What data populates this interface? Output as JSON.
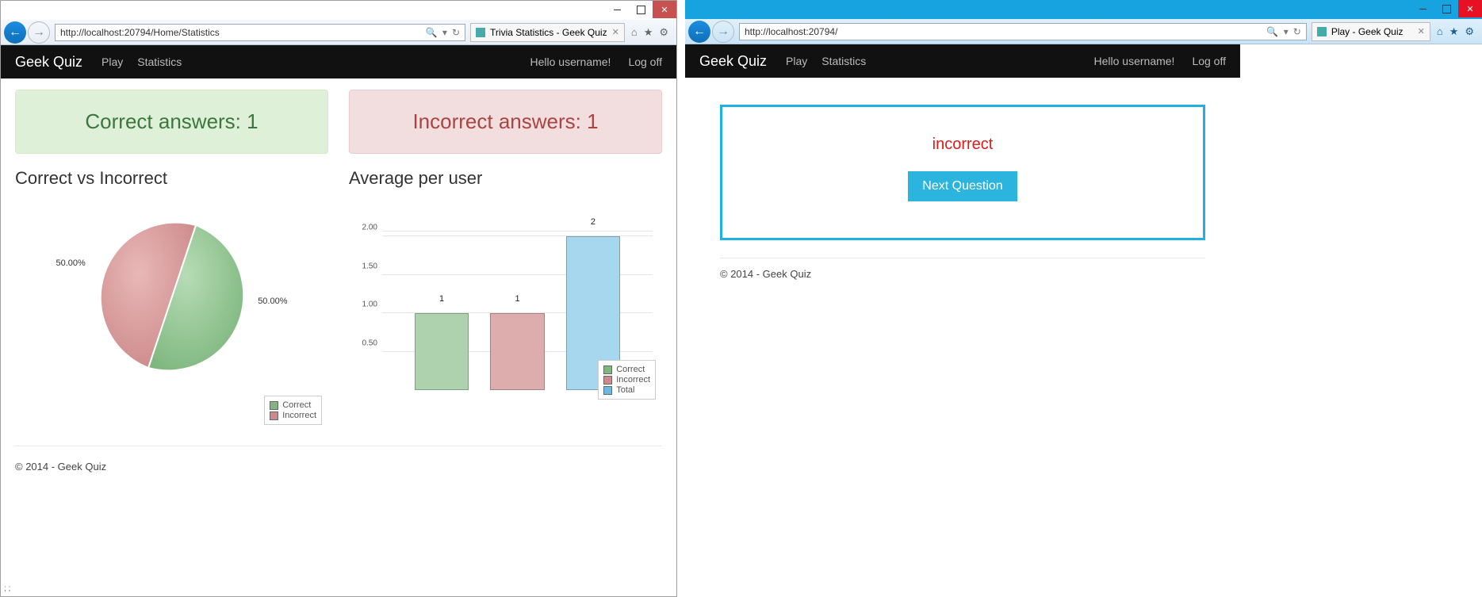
{
  "windows": {
    "left": {
      "url": "http://localhost:20794/Home/Statistics",
      "tab_title": "Trivia Statistics - Geek Quiz"
    },
    "right": {
      "url": "http://localhost:20794/",
      "tab_title": "Play - Geek Quiz"
    }
  },
  "navbar": {
    "brand": "Geek Quiz",
    "links": [
      "Play",
      "Statistics"
    ],
    "greeting": "Hello username!",
    "logoff": "Log off"
  },
  "stats": {
    "correct_panel": "Correct answers: 1",
    "incorrect_panel": "Incorrect answers: 1",
    "pie_title": "Correct vs Incorrect",
    "bar_title": "Average per user",
    "pie_labels": {
      "a": "50.00%",
      "b": "50.00%"
    },
    "legend": {
      "correct": "Correct",
      "incorrect": "Incorrect",
      "total": "Total"
    },
    "footer": "© 2014 - Geek Quiz",
    "tiny": "; ;"
  },
  "play": {
    "status": "incorrect",
    "next": "Next Question",
    "footer": "© 2014 - Geek Quiz"
  },
  "chart_data": [
    {
      "type": "pie",
      "title": "Correct vs Incorrect",
      "series": [
        {
          "name": "Correct",
          "value": 50.0,
          "color": "#8fc08f"
        },
        {
          "name": "Incorrect",
          "value": 50.0,
          "color": "#d88f8f"
        }
      ]
    },
    {
      "type": "bar",
      "title": "Average per user",
      "ylabel": "",
      "ylim": [
        0,
        2.5
      ],
      "yticks": [
        0.5,
        1.0,
        1.5,
        2.0
      ],
      "categories": [
        "Correct",
        "Incorrect",
        "Total"
      ],
      "series": [
        {
          "name": "Correct",
          "values": [
            1
          ],
          "color": "#99c699"
        },
        {
          "name": "Incorrect",
          "values": [
            1
          ],
          "color": "#d49a9a"
        },
        {
          "name": "Total",
          "values": [
            2
          ],
          "color": "#8fcbe8"
        }
      ],
      "bar_labels": [
        "1",
        "1",
        "2"
      ],
      "legend": [
        "Correct",
        "Incorrect",
        "Total"
      ]
    }
  ],
  "colors": {
    "green": "#99c699",
    "red": "#d49a9a",
    "blue": "#8fcbe8"
  }
}
